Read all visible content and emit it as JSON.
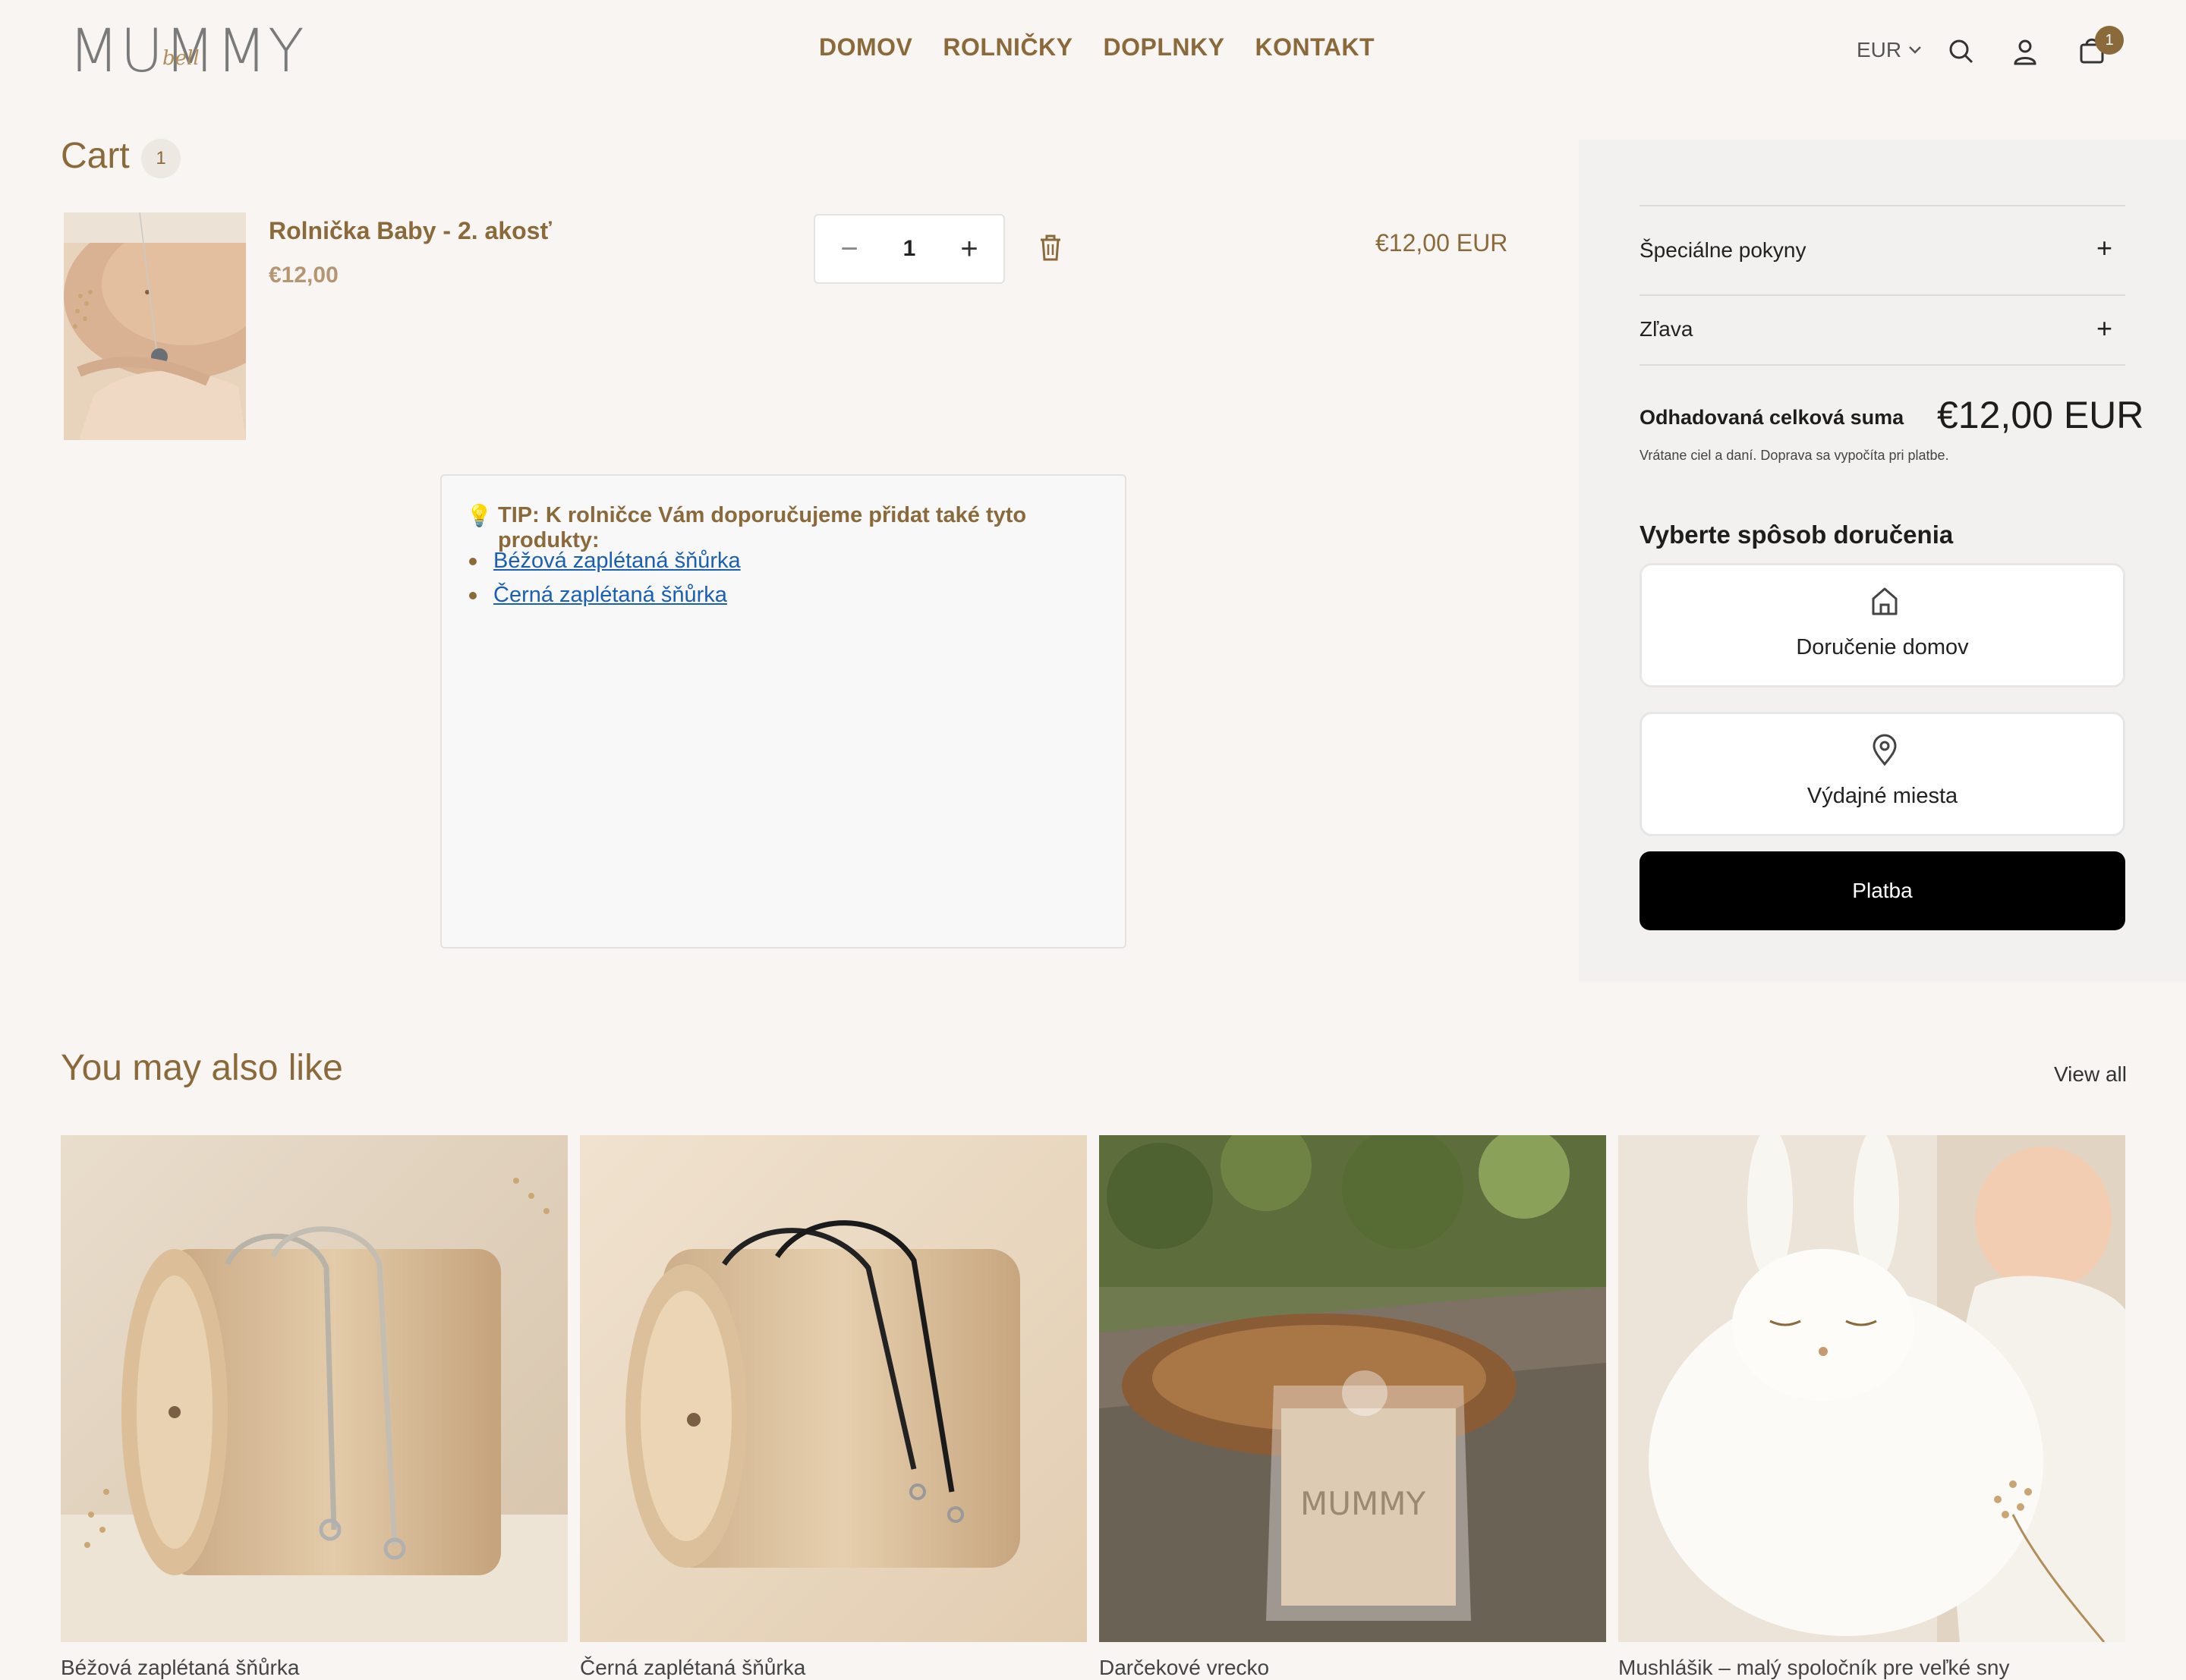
{
  "header": {
    "logo_text": "MUMMY",
    "logo_script": "bell",
    "nav": [
      "DOMOV",
      "ROLNIČKY",
      "DOPLNKY",
      "KONTAKT"
    ],
    "currency": "EUR",
    "cart_count": "1"
  },
  "cart": {
    "title": "Cart",
    "count": "1",
    "item": {
      "name": "Rolnička Baby - 2. akosť",
      "price": "€12,00",
      "quantity": "1",
      "line_total": "€12,00 EUR"
    },
    "tip": {
      "title": "TIP: K rolničce Vám doporučujeme přidat také tyto produkty:",
      "links": [
        "Béžová zaplétaná šňůrka",
        "Černá zaplétaná šňůrka"
      ]
    }
  },
  "summary": {
    "special_instructions": "Špeciálne pokyny",
    "discount": "Zľava",
    "estimated_total_label": "Odhadovaná celková suma",
    "estimated_total_value": "€12,00 EUR",
    "tax_note": "Vrátane ciel a daní. Doprava sa vypočíta pri platbe.",
    "shipping_title": "Vyberte spôsob doručenia",
    "shipping_options": [
      "Doručenie domov",
      "Výdajné miesta"
    ],
    "pay_button": "Platba"
  },
  "recommendations": {
    "title": "You may also like",
    "view_all": "View all",
    "products": [
      "Béžová zaplétaná šňůrka",
      "Černá zaplétaná šňůrka",
      "Darčekové vrecko",
      "Mushlášik – malý spoločník pre veľké sny"
    ]
  },
  "colors": {
    "brand_brown": "#8a6a3b",
    "background": "#f8f5f2",
    "button_black": "#000000"
  }
}
